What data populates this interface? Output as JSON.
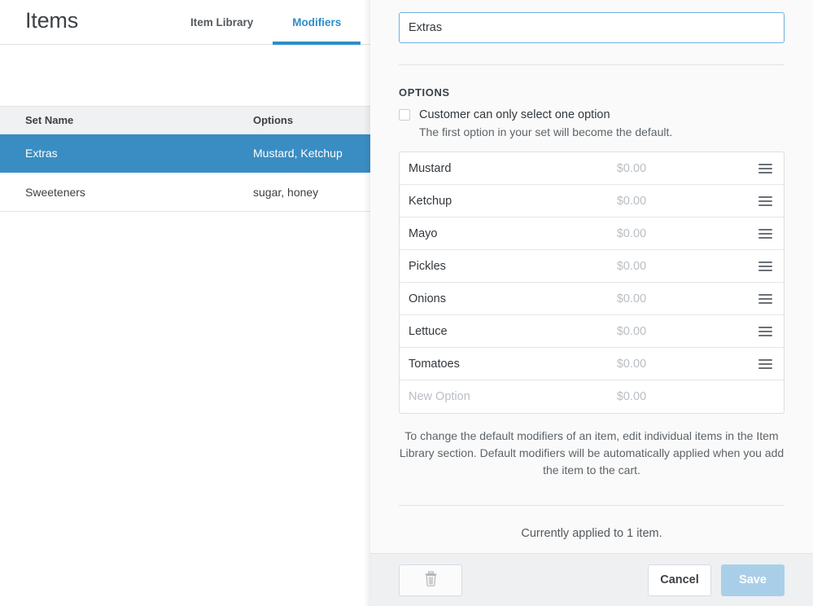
{
  "page": {
    "title": "Items",
    "tabs": [
      {
        "label": "Item Library",
        "active": false
      },
      {
        "label": "Modifiers",
        "active": true
      }
    ],
    "table": {
      "columns": {
        "name": "Set Name",
        "options": "Options"
      },
      "rows": [
        {
          "name": "Extras",
          "options": "Mustard, Ketchup",
          "selected": true
        },
        {
          "name": "Sweeteners",
          "options": "sugar, honey",
          "selected": false
        }
      ]
    }
  },
  "modal": {
    "name_input": {
      "value": "Extras",
      "placeholder": "Modifier Set Name"
    },
    "options_heading": "OPTIONS",
    "single_select": {
      "checked": false,
      "title": "Customer can only select one option",
      "subtitle": "The first option in your set will become the default."
    },
    "options": [
      {
        "name": "Mustard",
        "price": "$0.00",
        "placeholder": false
      },
      {
        "name": "Ketchup",
        "price": "$0.00",
        "placeholder": false
      },
      {
        "name": "Mayo",
        "price": "$0.00",
        "placeholder": false
      },
      {
        "name": "Pickles",
        "price": "$0.00",
        "placeholder": false
      },
      {
        "name": "Onions",
        "price": "$0.00",
        "placeholder": false
      },
      {
        "name": "Lettuce",
        "price": "$0.00",
        "placeholder": false
      },
      {
        "name": "Tomatoes",
        "price": "$0.00",
        "placeholder": false
      },
      {
        "name": "New Option",
        "price": "$0.00",
        "placeholder": true
      }
    ],
    "helper_note": "To change the default modifiers of an item, edit individual items in the Item Library section. Default modifiers will be automatically applied when you add the item to the cart.",
    "applied_note": "Currently applied to 1 item.",
    "footer": {
      "delete_label": "",
      "cancel_label": "Cancel",
      "save_label": "Save",
      "save_disabled": true
    }
  },
  "colors": {
    "accent": "#2e8dc9",
    "row_selected": "#3a8dc2",
    "save_disabled": "#a9cfe8",
    "muted_text": "#b9bec3",
    "delete_icon": "#d3d7da"
  }
}
